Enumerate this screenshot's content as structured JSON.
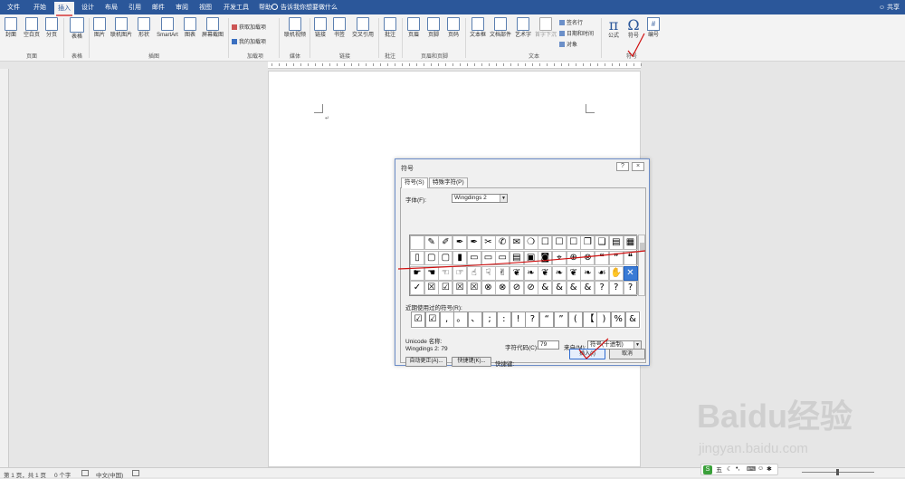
{
  "menu_tabs": [
    "文件",
    "开始",
    "插入",
    "设计",
    "布局",
    "引用",
    "邮件",
    "审阅",
    "视图",
    "开发工具",
    "帮助"
  ],
  "tell_me": "告诉我你想要做什么",
  "share": "共享",
  "ribbon": {
    "buttons": {
      "cover": "封面",
      "blank": "空白页",
      "pagebreak": "分页",
      "table": "表格",
      "picture": "图片",
      "online_picture": "联机图片",
      "shapes": "形状",
      "smartart": "SmartArt",
      "chart": "图表",
      "screenshot": "屏幕截图",
      "get_addins": "获取加载项",
      "my_addins": "我的加载项",
      "online_video": "联机视频",
      "link": "链接",
      "bookmark": "书签",
      "crossref": "交叉引用",
      "comment": "批注",
      "header": "页眉",
      "footer": "页脚",
      "pagenum": "页码",
      "textbox": "文本框",
      "quickparts": "文档部件",
      "wordart": "艺术字",
      "dropcap": "首字下沉",
      "signature": "签名行",
      "datetime": "日期和时间",
      "object": "对象",
      "equation": "公式",
      "symbol": "符号",
      "number": "编号"
    },
    "groups": {
      "pages": "页面",
      "tables": "表格",
      "illustrations": "插图",
      "addins": "加载项",
      "media": "媒体",
      "links": "链接",
      "comments": "批注",
      "headerfooter": "页眉和页脚",
      "text": "文本",
      "symbols": "符号"
    },
    "glyphs": {
      "equation": "π",
      "symbol": "Ω",
      "number": "#"
    }
  },
  "dialog": {
    "title": "符号",
    "tab_symbols": "符号(S)",
    "tab_special": "特殊字符(P)",
    "font_label": "字体(F):",
    "font_value": "Wingdings 2",
    "recent_label": "近期使用过的符号(R):",
    "recent": [
      "☑",
      "☑",
      ",",
      "。",
      "、",
      ";",
      ":",
      "!",
      "?",
      "“",
      "”",
      "(",
      "【",
      ")",
      "%",
      "&"
    ],
    "grid_rows": [
      [
        "",
        "✎",
        "✐",
        "✒",
        "✒",
        "✂",
        "✆",
        "✉",
        "❍",
        "☐",
        "☐",
        "☐",
        "❐",
        "❑",
        "▤",
        "▦"
      ],
      [
        "▯",
        "▢",
        "▢",
        "▮",
        "▭",
        "▭",
        "▭",
        "▤",
        "▣",
        "◙",
        "⌖",
        "⊕",
        "⊗",
        "❝",
        "❞",
        "❝"
      ],
      [
        "☛",
        "☚",
        "☜",
        "☞",
        "☝",
        "☟",
        "✌",
        "❦",
        "❧",
        "❦",
        "❧",
        "❦",
        "❧",
        "☙",
        "✋",
        "✕"
      ],
      [
        "✓",
        "☒",
        "☑",
        "☒",
        "☒",
        "⊗",
        "⊗",
        "⊘",
        "⊘",
        "&",
        "&",
        "&",
        "&",
        "?",
        "?",
        "?"
      ]
    ],
    "unicode_name_label": "Unicode 名称:",
    "char_name": "Wingdings 2: 79",
    "char_code_label": "字符代码(C):",
    "char_code": "79",
    "from_label": "来自(M):",
    "from_value": "符号(十进制)",
    "autocorrect": "自动更正(A)...",
    "shortcut_btn": "快捷键(K)...",
    "shortcut_label": "快捷键:",
    "insert": "插入(I)",
    "cancel": "取消",
    "help_glyph": "?",
    "close_glyph": "×"
  },
  "status": {
    "pages": "第 1 页，共 1 页",
    "words": "0 个字",
    "lang": "中文(中国)"
  },
  "ime": {
    "logo": "S",
    "mode": "五"
  },
  "watermark": {
    "main": "Baidu经验",
    "sub": "jingyan.baidu.com"
  },
  "annotation_color": "#d01010"
}
